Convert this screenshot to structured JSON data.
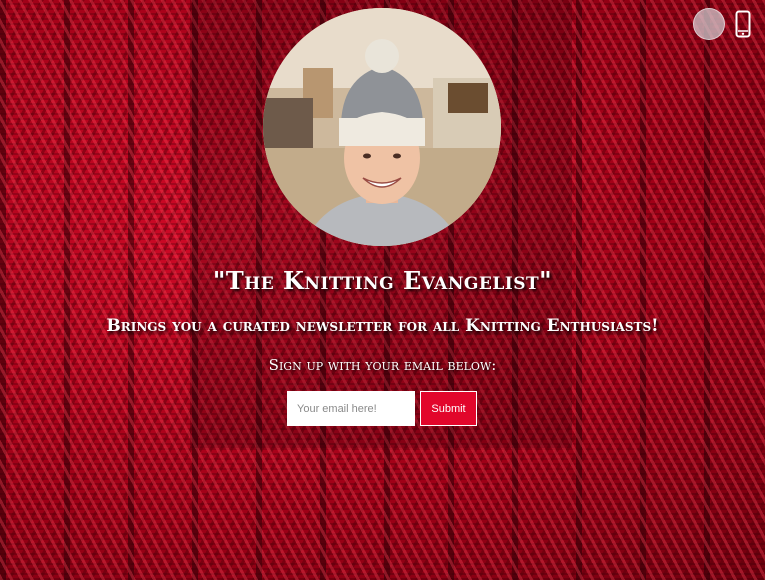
{
  "page": {
    "title": "\"The Knitting Evangelist\"",
    "tagline": "Brings you a curated newsletter for all Knitting Enthusiasts!",
    "signup_text": "Sign up with your email below:"
  },
  "form": {
    "email_placeholder": "Your email here!",
    "submit_label": "Submit"
  },
  "controls": {
    "theme_toggle_icon": "circle-toggle-icon",
    "device_icon": "mobile-phone-icon"
  },
  "colors": {
    "background": "#b0051d",
    "button": "#e2062b",
    "text": "#ffffff"
  }
}
